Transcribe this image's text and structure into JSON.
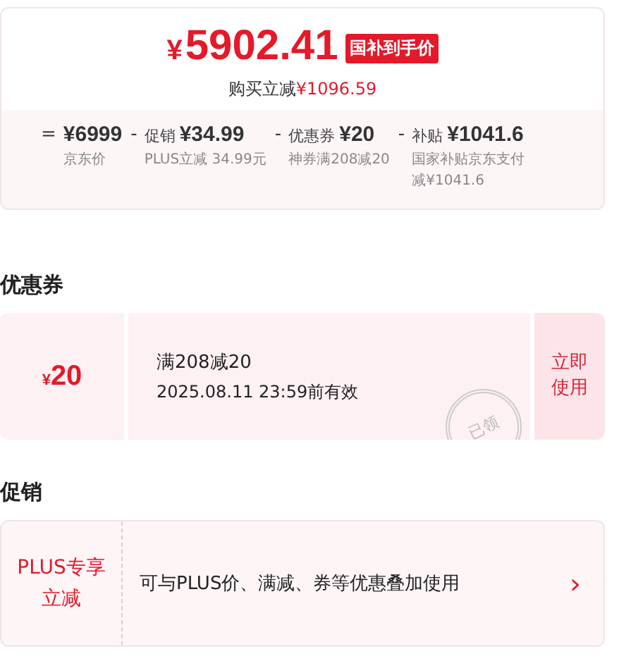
{
  "price_card": {
    "currency": "¥",
    "price": "5902.41",
    "tag": "国补到手价",
    "saving_label": "购买立减",
    "saving": "¥1096.59",
    "breakdown": [
      {
        "op": "=",
        "amount": "¥6999",
        "note": "京东价"
      },
      {
        "op": "-",
        "label": "促销",
        "amount": "¥34.99",
        "note": "PLUS立减 34.99元"
      },
      {
        "op": "-",
        "label": "优惠券",
        "amount": "¥20",
        "note": "神券满208减20"
      },
      {
        "op": "-",
        "label": "补贴",
        "amount": "¥1041.6",
        "note": "国家补贴京东支付减¥1041.6"
      }
    ]
  },
  "coupons": {
    "title": "优惠券",
    "items": [
      {
        "currency": "¥",
        "amount": "20",
        "condition": "满208减20",
        "validity": "2025.08.11 23:59前有效",
        "claimed": true,
        "stamp": "已领",
        "action": "立即使用"
      }
    ]
  },
  "promotions": {
    "title": "促销",
    "items": [
      {
        "tag": "PLUS专享立减",
        "text": "可与PLUS价、满减、券等优惠叠加使用",
        "chevron": "›"
      }
    ]
  }
}
